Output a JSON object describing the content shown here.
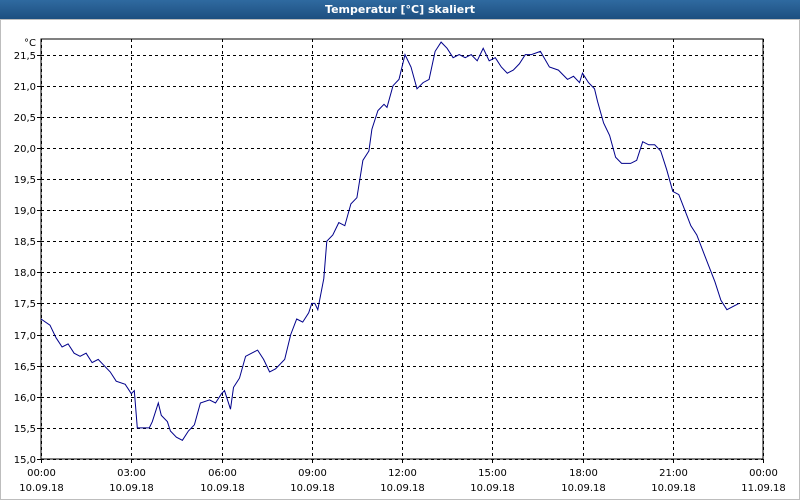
{
  "window": {
    "title": "Temperatur [°C] skaliert"
  },
  "chart_data": {
    "type": "line",
    "title": "Temperatur [°C] skaliert",
    "ylabel": "°C",
    "xlabel": "",
    "ylim": [
      15.0,
      21.75
    ],
    "xlim_hours": [
      0,
      24
    ],
    "grid": true,
    "y_ticks": [
      "15,0",
      "15,5",
      "16,0",
      "16,5",
      "17,0",
      "17,5",
      "18,0",
      "18,5",
      "19,0",
      "19,5",
      "20,0",
      "20,5",
      "21,0",
      "21,5"
    ],
    "x_ticks": [
      {
        "time": "00:00",
        "date": "10.09.18"
      },
      {
        "time": "03:00",
        "date": "10.09.18"
      },
      {
        "time": "06:00",
        "date": "10.09.18"
      },
      {
        "time": "09:00",
        "date": "10.09.18"
      },
      {
        "time": "12:00",
        "date": "10.09.18"
      },
      {
        "time": "15:00",
        "date": "10.09.18"
      },
      {
        "time": "18:00",
        "date": "10.09.18"
      },
      {
        "time": "21:00",
        "date": "10.09.18"
      },
      {
        "time": "00:00",
        "date": "11.09.18"
      }
    ],
    "series": [
      {
        "color": "#00008b",
        "x_hours": [
          0.0,
          0.3,
          0.5,
          0.7,
          0.9,
          1.1,
          1.3,
          1.5,
          1.7,
          1.9,
          2.1,
          2.3,
          2.5,
          2.8,
          3.0,
          3.1,
          3.2,
          3.4,
          3.6,
          3.7,
          3.9,
          4.0,
          4.2,
          4.3,
          4.5,
          4.7,
          4.9,
          5.1,
          5.3,
          5.6,
          5.8,
          6.0,
          6.1,
          6.3,
          6.4,
          6.6,
          6.8,
          7.0,
          7.2,
          7.4,
          7.6,
          7.8,
          8.1,
          8.3,
          8.5,
          8.7,
          8.9,
          9.0,
          9.1,
          9.2,
          9.4,
          9.5,
          9.7,
          9.9,
          10.1,
          10.3,
          10.5,
          10.7,
          10.9,
          11.0,
          11.2,
          11.4,
          11.5,
          11.7,
          11.9,
          12.1,
          12.3,
          12.5,
          12.7,
          12.9,
          13.1,
          13.3,
          13.5,
          13.7,
          13.9,
          14.1,
          14.3,
          14.5,
          14.7,
          14.9,
          15.1,
          15.3,
          15.5,
          15.7,
          15.9,
          16.1,
          16.3,
          16.6,
          16.9,
          17.2,
          17.5,
          17.7,
          17.9,
          18.0,
          18.2,
          18.4,
          18.5,
          18.7,
          18.9,
          19.1,
          19.3,
          19.6,
          19.8,
          20.0,
          20.2,
          20.4,
          20.6,
          20.8,
          21.0,
          21.2,
          21.4,
          21.6,
          21.8,
          22.0,
          22.2,
          22.4,
          22.6,
          22.8,
          23.0,
          23.2,
          23.4,
          23.6
        ],
        "y": [
          17.25,
          17.15,
          16.95,
          16.8,
          16.85,
          16.7,
          16.65,
          16.7,
          16.55,
          16.6,
          16.5,
          16.4,
          16.25,
          16.2,
          16.05,
          16.1,
          15.5,
          15.5,
          15.5,
          15.6,
          15.9,
          15.7,
          15.6,
          15.45,
          15.35,
          15.3,
          15.45,
          15.55,
          15.9,
          15.95,
          15.9,
          16.05,
          16.1,
          15.8,
          16.15,
          16.3,
          16.65,
          16.7,
          16.75,
          16.6,
          16.4,
          16.45,
          16.6,
          17.0,
          17.25,
          17.2,
          17.35,
          17.5,
          17.5,
          17.4,
          17.9,
          18.5,
          18.6,
          18.8,
          18.75,
          19.1,
          19.2,
          19.8,
          19.95,
          20.3,
          20.6,
          20.7,
          20.65,
          21.0,
          21.1,
          21.5,
          21.3,
          20.95,
          21.05,
          21.1,
          21.55,
          21.7,
          21.6,
          21.45,
          21.5,
          21.45,
          21.5,
          21.4,
          21.6,
          21.4,
          21.45,
          21.3,
          21.2,
          21.25,
          21.35,
          21.5,
          21.5,
          21.55,
          21.3,
          21.25,
          21.1,
          21.15,
          21.05,
          21.2,
          21.05,
          20.95,
          20.75,
          20.4,
          20.2,
          19.85,
          19.75,
          19.75,
          19.8,
          20.1,
          20.05,
          20.05,
          19.95,
          19.65,
          19.3,
          19.25,
          19.0,
          18.75,
          18.6,
          18.35,
          18.1,
          17.85,
          17.55,
          17.4,
          17.45,
          17.5
        ]
      }
    ]
  }
}
